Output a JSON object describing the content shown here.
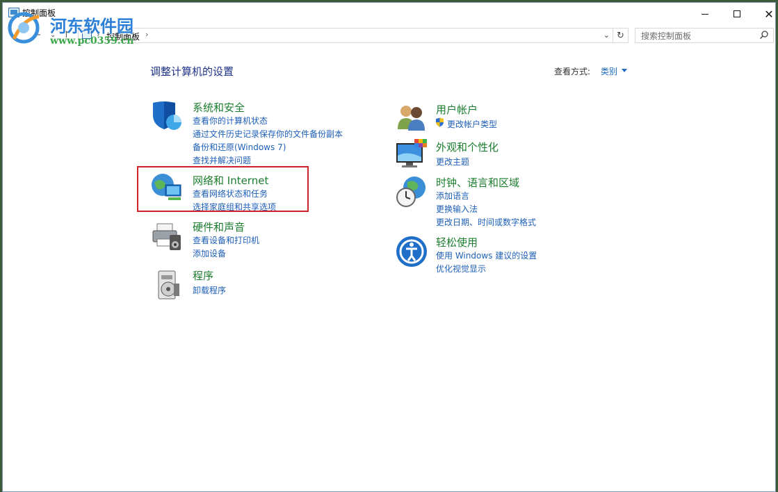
{
  "window": {
    "title": "控制面板"
  },
  "watermark": {
    "title": "河东软件园",
    "url": "www.pc0359.cn"
  },
  "address": {
    "path": "控制面板"
  },
  "search": {
    "placeholder": "搜索控制面板"
  },
  "main": {
    "heading": "调整计算机的设置",
    "view_by_label": "查看方式:",
    "view_by_value": "类别",
    "left_categories": [
      {
        "title": "系统和安全",
        "icon": "shield-icon",
        "links": [
          "查看你的计算机状态",
          "通过文件历史记录保存你的文件备份副本",
          "备份和还原(Windows 7)",
          "查找并解决问题"
        ]
      },
      {
        "title": "网络和 Internet",
        "icon": "network-globe-icon",
        "links": [
          "查看网络状态和任务",
          "选择家庭组和共享选项"
        ]
      },
      {
        "title": "硬件和声音",
        "icon": "printer-speaker-icon",
        "links": [
          "查看设备和打印机",
          "添加设备"
        ]
      },
      {
        "title": "程序",
        "icon": "programs-disc-icon",
        "links": [
          "卸载程序"
        ]
      }
    ],
    "right_categories": [
      {
        "title": "用户帐户",
        "icon": "users-icon",
        "links": [
          "更改帐户类型"
        ]
      },
      {
        "title": "外观和个性化",
        "icon": "monitor-palette-icon",
        "links": [
          "更改主题"
        ]
      },
      {
        "title": "时钟、语言和区域",
        "icon": "globe-clock-icon",
        "links": [
          "添加语言",
          "更换输入法",
          "更改日期、时间或数字格式"
        ]
      },
      {
        "title": "轻松使用",
        "icon": "ease-of-access-icon",
        "links": [
          "使用 Windows 建议的设置",
          "优化视觉显示"
        ]
      }
    ]
  },
  "colors": {
    "accent_link": "#1e5fb8",
    "category_title": "#1b7d2e",
    "heading": "#1e3287",
    "highlight": "#d0202a"
  }
}
